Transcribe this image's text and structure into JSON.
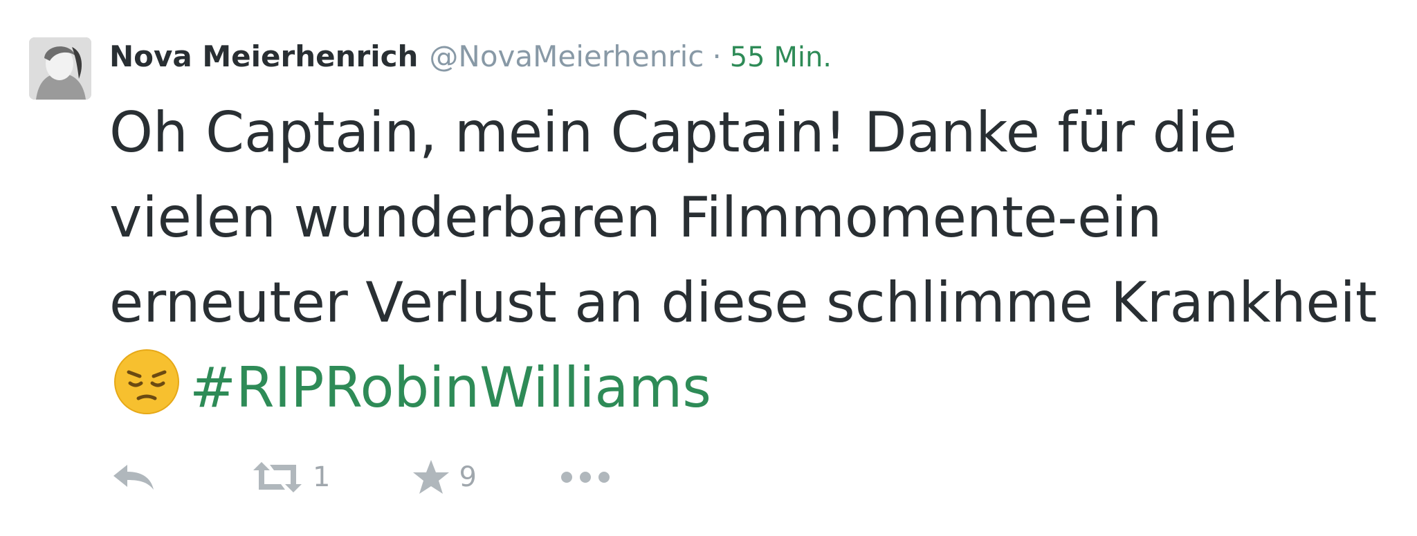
{
  "tweet": {
    "author": {
      "name": "Nova Meierhenrich",
      "handle": "@NovaMeierhenric",
      "avatar_icon": "user-avatar"
    },
    "separator": "·",
    "time": "55 Min.",
    "text": "Oh Captain, mein Captain! Danke für die vielen wunderbaren Filmmomente-ein erneuter Verlust an diese schlimme Krankheit",
    "emoji": "pensive-face-emoji",
    "hashtag": "#RIPRobinWilliams",
    "actions": {
      "reply_icon": "reply-icon",
      "retweet_icon": "retweet-icon",
      "retweet_count": "1",
      "favorite_icon": "star-icon",
      "favorite_count": "9",
      "more_icon": "more-dots-icon"
    }
  },
  "colors": {
    "text": "#292f33",
    "muted": "#8899a6",
    "link": "#2e8b57",
    "action_icons": "#b0b7bc"
  }
}
